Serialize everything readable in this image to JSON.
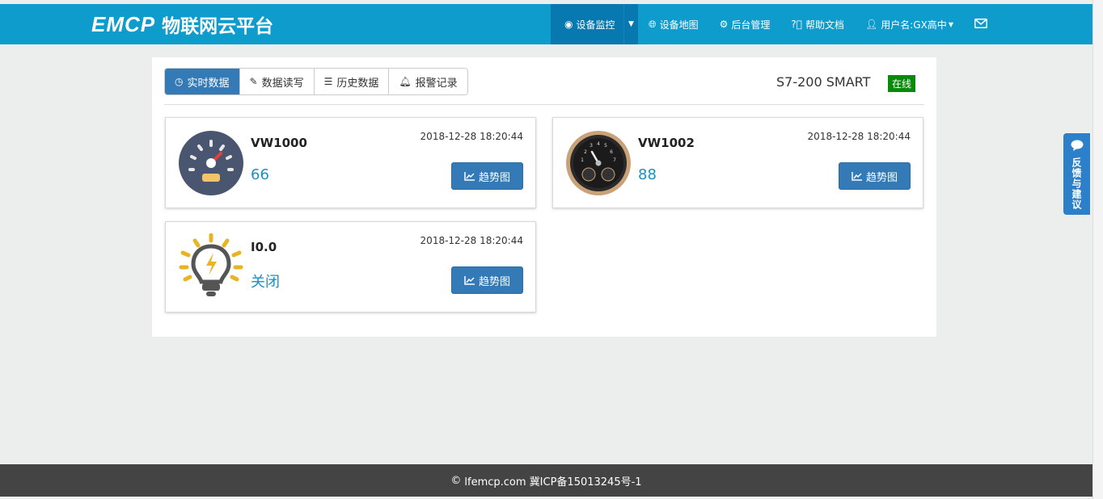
{
  "header": {
    "logo_mark": "EMCP",
    "logo_text": "物联网云平台",
    "nav": [
      {
        "label": "设备监控",
        "icon": "eye-icon",
        "active": true
      },
      {
        "label": "设备地图",
        "icon": "globe-icon"
      },
      {
        "label": "后台管理",
        "icon": "gears-icon"
      },
      {
        "label": "帮助文档",
        "icon": "question-icon"
      },
      {
        "label": "用户名:GX高中",
        "icon": "user-icon"
      },
      {
        "label": "",
        "icon": "envelope-icon"
      }
    ]
  },
  "tabs": [
    {
      "label": "实时数据",
      "icon": "clock-icon",
      "active": true
    },
    {
      "label": "数据读写",
      "icon": "pencil-icon"
    },
    {
      "label": "历史数据",
      "icon": "list-icon"
    },
    {
      "label": "报警记录",
      "icon": "bell-icon"
    }
  ],
  "device": {
    "name": "S7-200 SMART",
    "status": "在线",
    "status_color": "#0a8a0a"
  },
  "cards": [
    {
      "variable": "VW1000",
      "value": "66",
      "time": "2018-12-28 18:20:44",
      "button": "趋势图",
      "icon": "speedometer-icon"
    },
    {
      "variable": "VW1002",
      "value": "88",
      "time": "2018-12-28 18:20:44",
      "button": "趋势图",
      "icon": "clock-gauge-icon"
    },
    {
      "variable": "I0.0",
      "value": "关闭",
      "time": "2018-12-28 18:20:44",
      "button": "趋势图",
      "icon": "lightbulb-icon"
    }
  ],
  "feedback": {
    "label": "反馈与建议",
    "icon": "comment-icon"
  },
  "footer": {
    "text": "lfemcp.com 冀ICP备15013245号-1",
    "icon": "copyright-icon"
  },
  "colors": {
    "navbar": "#0e9ccd",
    "accent": "#337ab7",
    "value": "#1a8fc5"
  }
}
